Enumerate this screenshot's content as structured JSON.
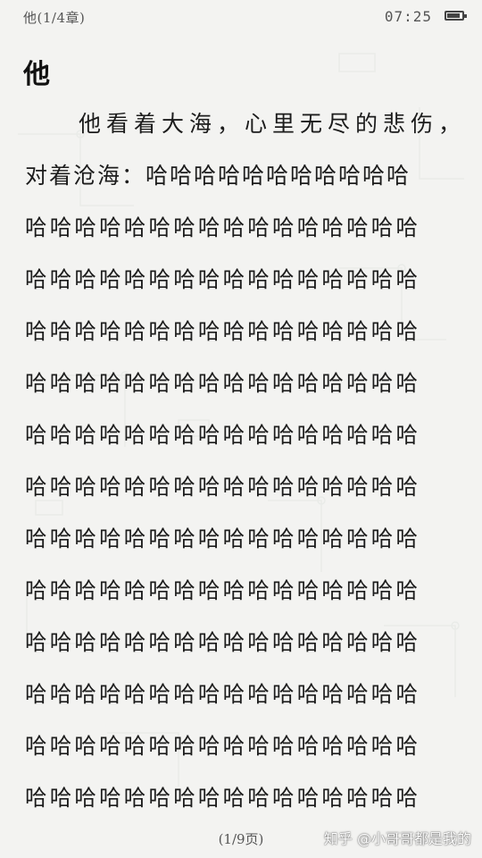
{
  "status_bar": {
    "chapter": "他(1/4章)",
    "time": "07:25",
    "battery_level": 0.75
  },
  "chapter_title": "他",
  "lines": [
    "他看着大海，心里无尽的悲伤，",
    "对着沧海：哈哈哈哈哈哈哈哈哈哈哈",
    "哈哈哈哈哈哈哈哈哈哈哈哈哈哈哈哈",
    "哈哈哈哈哈哈哈哈哈哈哈哈哈哈哈哈",
    "哈哈哈哈哈哈哈哈哈哈哈哈哈哈哈哈",
    "哈哈哈哈哈哈哈哈哈哈哈哈哈哈哈哈",
    "哈哈哈哈哈哈哈哈哈哈哈哈哈哈哈哈",
    "哈哈哈哈哈哈哈哈哈哈哈哈哈哈哈哈",
    "哈哈哈哈哈哈哈哈哈哈哈哈哈哈哈哈",
    "哈哈哈哈哈哈哈哈哈哈哈哈哈哈哈哈",
    "哈哈哈哈哈哈哈哈哈哈哈哈哈哈哈哈",
    "哈哈哈哈哈哈哈哈哈哈哈哈哈哈哈哈",
    "哈哈哈哈哈哈哈哈哈哈哈哈哈哈哈哈",
    "哈哈哈哈哈哈哈哈哈哈哈哈哈哈哈哈"
  ],
  "page_indicator": "(1/9页)",
  "watermark": "知乎 @小哥哥都是我的",
  "colors": {
    "background": "#f3f3f1",
    "text": "#1c1c1c",
    "muted": "#555555"
  }
}
